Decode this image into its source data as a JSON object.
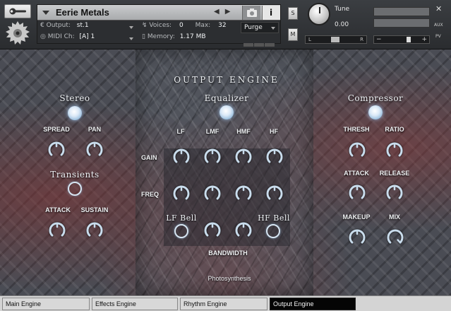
{
  "header": {
    "instrument_name": "Eerie Metals",
    "output_label": "Output:",
    "output_value": "st.1",
    "midi_label": "MIDI Ch:",
    "midi_value": "[A]  1",
    "voices_label": "Voices:",
    "voices_value": "0",
    "max_label": "Max:",
    "max_value": "32",
    "memory_label": "Memory:",
    "memory_value": "1.17 MB",
    "purge_label": "Purge",
    "info_glyph": "i",
    "solo_label": "S",
    "mute_label": "M",
    "tune_label": "Tune",
    "tune_value": "0.00",
    "pan_left": "L",
    "pan_right": "R",
    "vol_minus": "−",
    "vol_plus": "+",
    "aux_label": "AUX",
    "pv_label": "PV"
  },
  "main": {
    "heading": "OUTPUT ENGINE",
    "stereo": {
      "title": "Stereo",
      "spread": "SPREAD",
      "pan": "PAN"
    },
    "transients": {
      "title": "Transients",
      "attack": "ATTACK",
      "sustain": "SUSTAIN"
    },
    "equalizer": {
      "title": "Equalizer",
      "bands": [
        "LF",
        "LMF",
        "HMF",
        "HF"
      ],
      "gain": "GAIN",
      "freq": "FREQ",
      "lf_bell": "LF Bell",
      "hf_bell": "HF Bell",
      "bandwidth": "BANDWIDTH"
    },
    "compressor": {
      "title": "Compressor",
      "thresh": "THRESH",
      "ratio": "RATIO",
      "attack": "ATTACK",
      "release": "RELEASE",
      "makeup": "MAKEUP",
      "mix": "MIX"
    },
    "preset_name": "Photosynthesis"
  },
  "tabs": [
    "Main Engine",
    "Effects Engine",
    "Rhythm Engine",
    "Output Engine"
  ],
  "colors": {
    "accent_led": "#dbe9f7",
    "knob_arc": "#c9dcec",
    "active_tab_bg": "#050505"
  }
}
